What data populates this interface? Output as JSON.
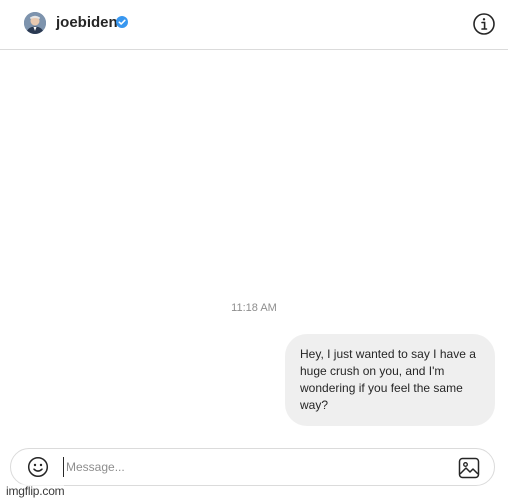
{
  "header": {
    "username": "joebiden",
    "avatar_icon": "profile-photo",
    "verified_icon": "verified-badge-icon",
    "info_icon": "info-icon"
  },
  "thread": {
    "timestamp": "11:18 AM",
    "messages": [
      {
        "sender": "self",
        "text": "Hey, I just wanted to say I have a huge crush on you, and I'm wondering if you feel the same way?"
      }
    ]
  },
  "composer": {
    "placeholder": "Message...",
    "value": "",
    "emoji_icon": "emoji-icon",
    "image_icon": "image-icon"
  },
  "watermark": "imgflip.com",
  "colors": {
    "accent_verified": "#3897f0",
    "bubble_bg": "#efefef",
    "border": "#dbdbdb",
    "muted_text": "#8e8e8e"
  }
}
